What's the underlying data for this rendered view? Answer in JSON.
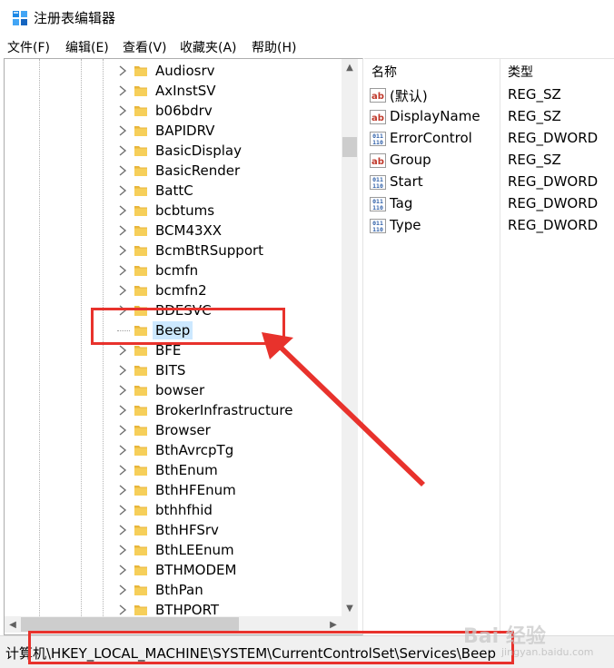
{
  "window": {
    "title": "注册表编辑器"
  },
  "menu": [
    "文件(F)",
    "编辑(E)",
    "查看(V)",
    "收藏夹(A)",
    "帮助(H)"
  ],
  "tree": {
    "selected": "Beep",
    "items": [
      {
        "label": "Audiosrv",
        "expandable": true
      },
      {
        "label": "AxInstSV",
        "expandable": true
      },
      {
        "label": "b06bdrv",
        "expandable": true
      },
      {
        "label": "BAPIDRV",
        "expandable": true
      },
      {
        "label": "BasicDisplay",
        "expandable": true
      },
      {
        "label": "BasicRender",
        "expandable": true
      },
      {
        "label": "BattC",
        "expandable": true
      },
      {
        "label": "bcbtums",
        "expandable": true
      },
      {
        "label": "BCM43XX",
        "expandable": true
      },
      {
        "label": "BcmBtRSupport",
        "expandable": true
      },
      {
        "label": "bcmfn",
        "expandable": true
      },
      {
        "label": "bcmfn2",
        "expandable": true
      },
      {
        "label": "BDESVC",
        "expandable": true
      },
      {
        "label": "Beep",
        "expandable": false
      },
      {
        "label": "BFE",
        "expandable": true
      },
      {
        "label": "BITS",
        "expandable": true
      },
      {
        "label": "bowser",
        "expandable": true
      },
      {
        "label": "BrokerInfrastructure",
        "expandable": true
      },
      {
        "label": "Browser",
        "expandable": true
      },
      {
        "label": "BthAvrcpTg",
        "expandable": true
      },
      {
        "label": "BthEnum",
        "expandable": true
      },
      {
        "label": "BthHFEnum",
        "expandable": true
      },
      {
        "label": "bthhfhid",
        "expandable": true
      },
      {
        "label": "BthHFSrv",
        "expandable": true
      },
      {
        "label": "BthLEEnum",
        "expandable": true
      },
      {
        "label": "BTHMODEM",
        "expandable": true
      },
      {
        "label": "BthPan",
        "expandable": true
      },
      {
        "label": "BTHPORT",
        "expandable": true
      }
    ]
  },
  "values": {
    "headers": {
      "name": "名称",
      "type": "类型"
    },
    "rows": [
      {
        "name": "(默认)",
        "type": "REG_SZ",
        "icon": "string-value-icon"
      },
      {
        "name": "DisplayName",
        "type": "REG_SZ",
        "icon": "string-value-icon"
      },
      {
        "name": "ErrorControl",
        "type": "REG_DWORD",
        "icon": "binary-value-icon"
      },
      {
        "name": "Group",
        "type": "REG_SZ",
        "icon": "string-value-icon"
      },
      {
        "name": "Start",
        "type": "REG_DWORD",
        "icon": "binary-value-icon"
      },
      {
        "name": "Tag",
        "type": "REG_DWORD",
        "icon": "binary-value-icon"
      },
      {
        "name": "Type",
        "type": "REG_DWORD",
        "icon": "binary-value-icon"
      }
    ]
  },
  "status": {
    "path": "计算机\\HKEY_LOCAL_MACHINE\\SYSTEM\\CurrentControlSet\\Services\\Beep"
  },
  "watermark": {
    "main": "Bai 经验",
    "sub": "jingyan.baidu.com"
  },
  "colors": {
    "annotation": "#e8322c",
    "selection": "#cce8ff",
    "folder": "#f3c24a",
    "string_icon": "#c0392b",
    "binary_icon": "#2e5fa8"
  }
}
